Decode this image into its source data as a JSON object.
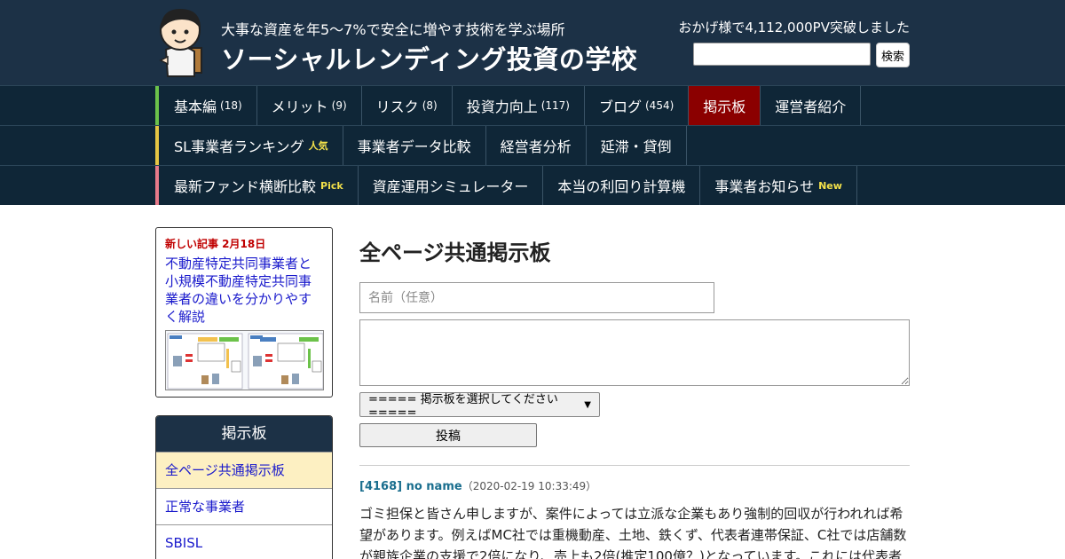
{
  "header": {
    "tagline": "大事な資産を年5～7%で安全に増やす技術を学ぶ場所",
    "site_title": "ソーシャルレンディング投資の学校",
    "pv_text": "おかげ様で4,112,000PV突破しました",
    "search_value": "",
    "search_button": "検索"
  },
  "nav": {
    "row1": [
      {
        "label": "基本編",
        "count": "(18)"
      },
      {
        "label": "メリット",
        "count": "(9)"
      },
      {
        "label": "リスク",
        "count": "(8)"
      },
      {
        "label": "投資力向上",
        "count": "(117)"
      },
      {
        "label": "ブログ",
        "count": "(454)"
      },
      {
        "label": "掲示板",
        "count": ""
      },
      {
        "label": "運営者紹介",
        "count": ""
      }
    ],
    "row2": [
      {
        "label": "SL事業者ランキング",
        "tag": "人気"
      },
      {
        "label": "事業者データ比較",
        "tag": ""
      },
      {
        "label": "経営者分析",
        "tag": ""
      },
      {
        "label": "延滞・貸倒",
        "tag": ""
      }
    ],
    "row3": [
      {
        "label": "最新ファンド横断比較",
        "tag": "Pick"
      },
      {
        "label": "資産運用シミュレーター",
        "tag": ""
      },
      {
        "label": "本当の利回り計算機",
        "tag": ""
      },
      {
        "label": "事業者お知らせ",
        "tag": "New"
      }
    ],
    "colors": {
      "active": "#8b0000",
      "row1_accent": "#6cc24a",
      "row2_accent": "#e6c643",
      "row3_accent": "#e77a8a"
    }
  },
  "sidebar": {
    "new_label": "新しい記事 2月18日",
    "new_article": "不動産特定共同事業者と小規模不動産特定共同事業者の違いを分かりやすく解説",
    "menu_title": "掲示板",
    "menu_items": [
      "全ページ共通掲示板",
      "正常な事業者",
      "SBISL"
    ]
  },
  "main": {
    "page_title": "全ページ共通掲示板",
    "name_placeholder": "名前（任意）",
    "select_value": "===== 掲示板を選択してください =====",
    "post_button": "投稿",
    "post": {
      "id": "[4168] no name",
      "date": "（2020-02-19 10:33:49）",
      "body": "ゴミ担保と皆さん申しますが、案件によっては立派な企業もあり強制的回収が行われれば希望があります。例えばMC社では重機動産、土地、鉄くず、代表者連帯保証、C社では店舗数が親族企業の支援で2倍になり、売上も2倍(推定100億？)となっています。これには代表者"
    }
  }
}
